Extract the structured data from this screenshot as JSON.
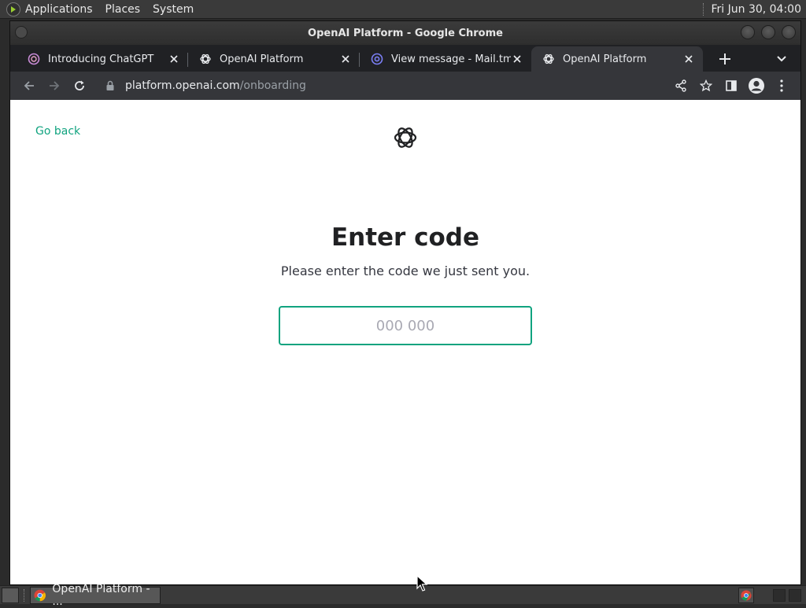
{
  "top_panel": {
    "menus": [
      "Applications",
      "Places",
      "System"
    ],
    "clock": "Fri Jun 30, 04:00"
  },
  "window": {
    "title": "OpenAI Platform - Google Chrome"
  },
  "tabs": [
    {
      "title": "Introducing ChatGPT",
      "icon": "chatgpt-favicon"
    },
    {
      "title": "OpenAI Platform",
      "icon": "openai-favicon"
    },
    {
      "title": "View message - Mail.tm",
      "icon": "mailtm-favicon"
    },
    {
      "title": "OpenAI Platform",
      "icon": "openai-favicon",
      "active": true
    }
  ],
  "toolbar": {
    "url_host": "platform.openai.com",
    "url_path": "/onboarding"
  },
  "page": {
    "go_back": "Go back",
    "heading": "Enter code",
    "subtext": "Please enter the code we just sent you.",
    "code_input": {
      "value": "",
      "placeholder": "000 000"
    },
    "accent_color": "#10a37f"
  },
  "taskbar": {
    "task_label": "OpenAI Platform - ..."
  }
}
